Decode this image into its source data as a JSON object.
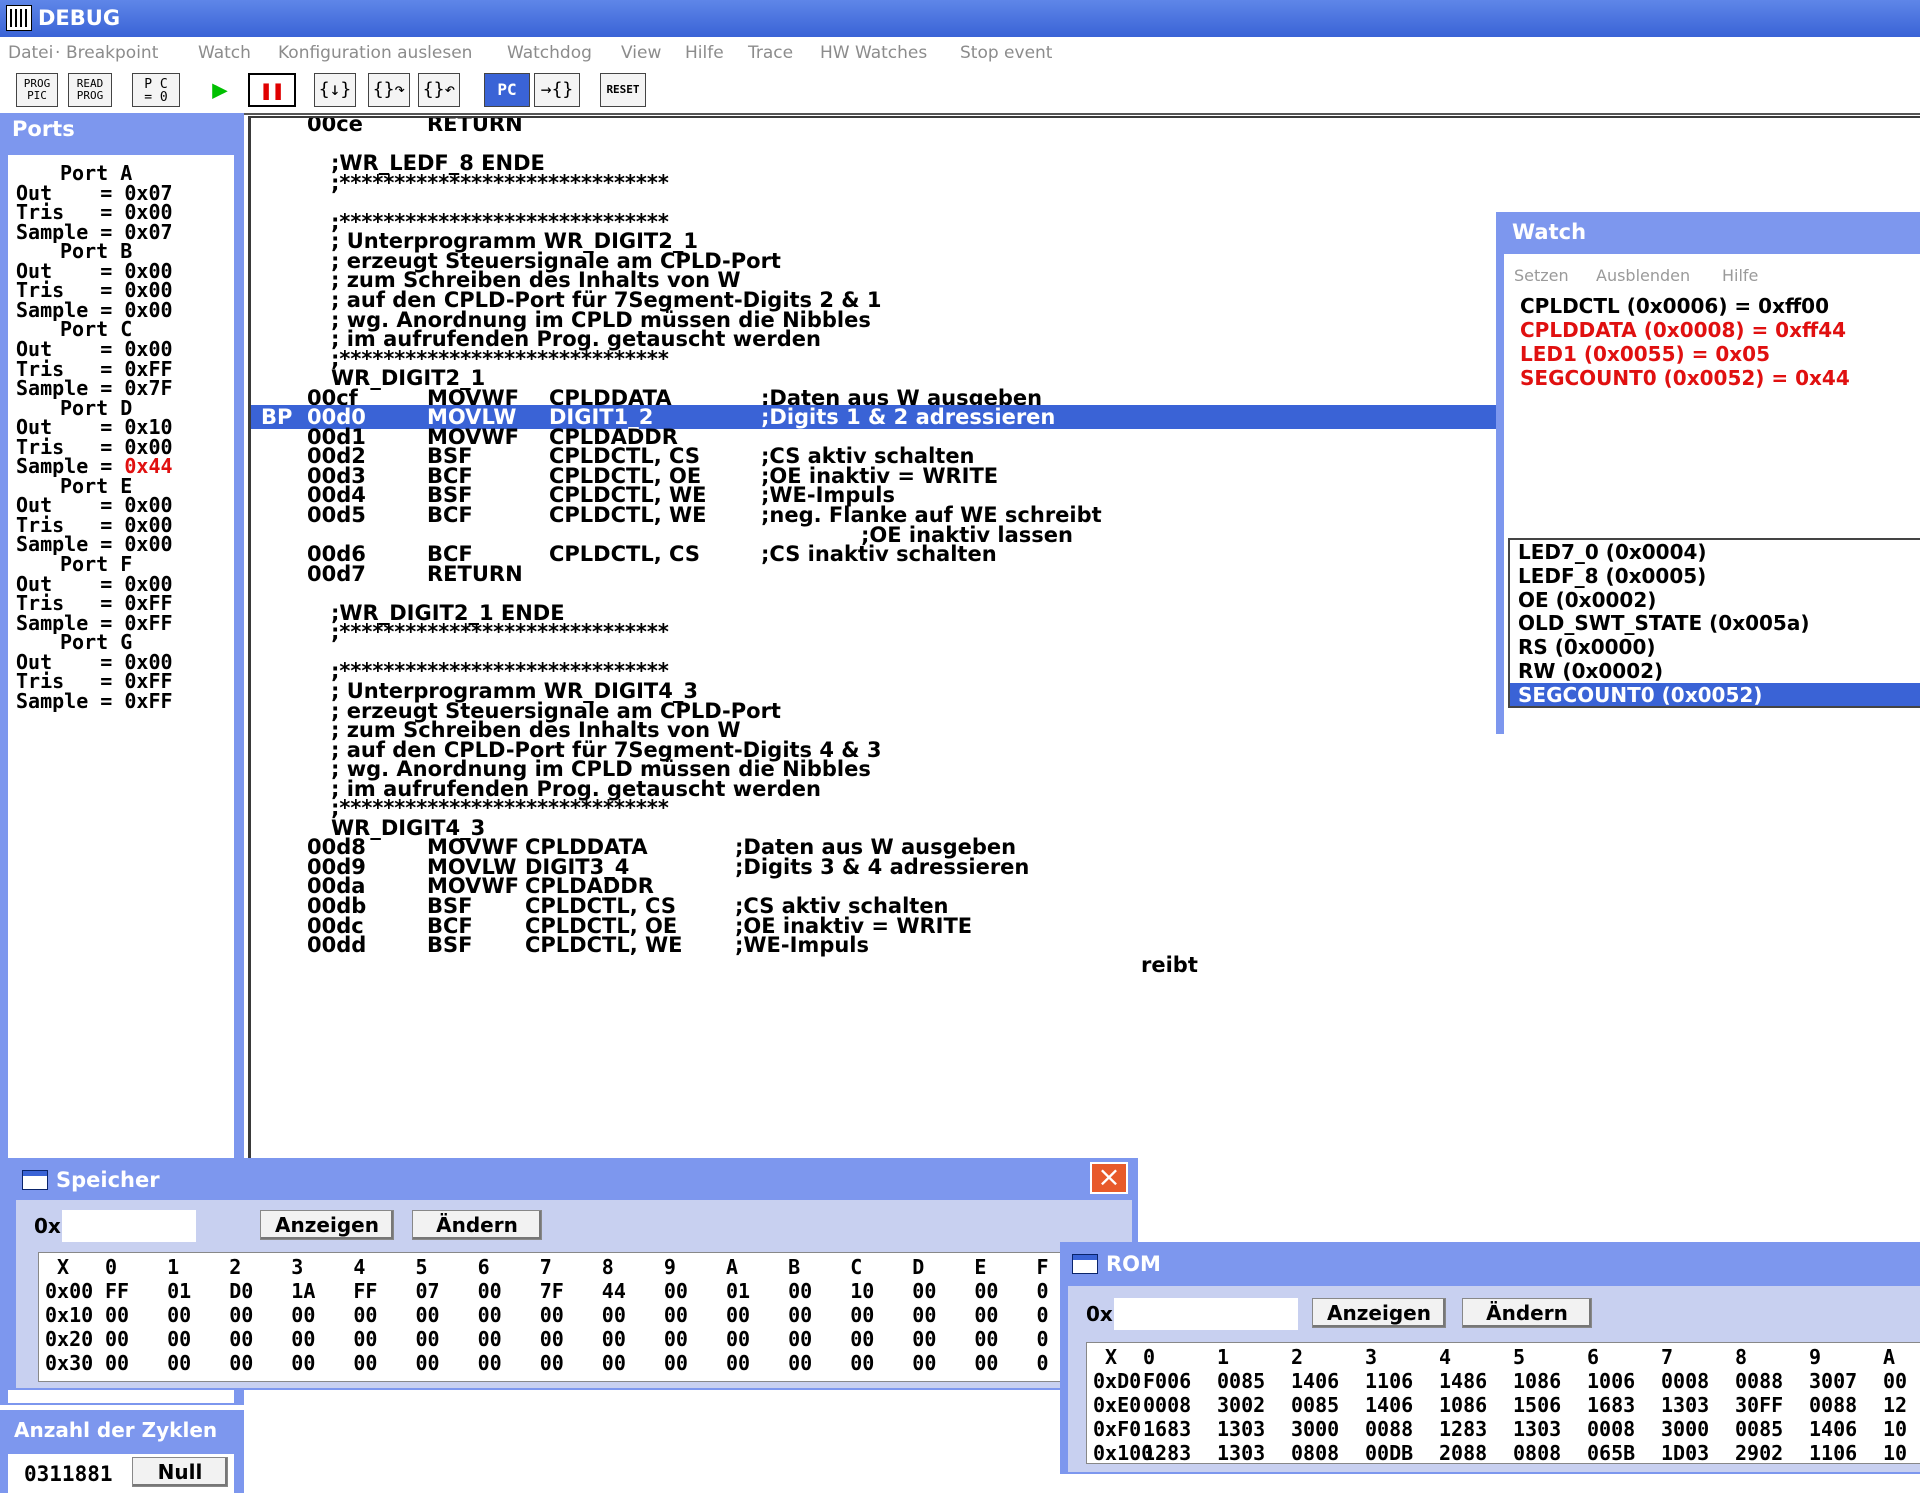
{
  "title": "DEBUG",
  "menu": [
    "Datei",
    "·",
    "Breakpoint",
    "Watch",
    "Konfiguration auslesen",
    "Watchdog",
    "View",
    "Hilfe",
    "Trace",
    "HW Watches",
    "Stop event"
  ],
  "toolbar": {
    "prog_pic": [
      "PROG",
      "PIC"
    ],
    "read_prog": [
      "READ",
      "PROG"
    ],
    "pc_zero": [
      "P C",
      "= 0"
    ],
    "run": "▶",
    "pause": "❚❚",
    "step_into": "{↓}",
    "step_over": "{}↷",
    "step_out": "{}↶",
    "pc": "PC",
    "goto_pc": "→{}",
    "reset": "RESET"
  },
  "ports": {
    "title": "Ports",
    "lines": [
      {
        "hdr": "Port A"
      },
      {
        "text": "Out    = 0x07"
      },
      {
        "text": "Tris   = 0x00"
      },
      {
        "text": "Sample = 0x07"
      },
      {
        "hdr": "Port B"
      },
      {
        "text": "Out    = 0x00"
      },
      {
        "text": "Tris   = 0x00"
      },
      {
        "text": "Sample = 0x00"
      },
      {
        "hdr": "Port C"
      },
      {
        "text": "Out    = 0x00"
      },
      {
        "text": "Tris   = 0xFF"
      },
      {
        "text": "Sample = 0x7F"
      },
      {
        "hdr": "Port D"
      },
      {
        "text": "Out    = 0x10"
      },
      {
        "text": "Tris   = 0x00"
      },
      {
        "text": "Sample = ",
        "red": "0x44"
      },
      {
        "hdr": "Port E"
      },
      {
        "text": "Out    = 0x00"
      },
      {
        "text": "Tris   = 0x00"
      },
      {
        "text": "Sample = 0x00"
      },
      {
        "hdr": "Port F"
      },
      {
        "text": "Out    = 0x00"
      },
      {
        "text": "Tris   = 0xFF"
      },
      {
        "text": "Sample = 0xFF"
      },
      {
        "hdr": "Port G"
      },
      {
        "text": "Out    = 0x00"
      },
      {
        "text": "Tris   = 0xFF"
      },
      {
        "text": "Sample = 0xFF"
      }
    ]
  },
  "code": [
    {
      "addr": "00ce",
      "op": "RETURN",
      "arg": "",
      "cmt": ""
    },
    {
      "blank": true
    },
    {
      "text": ";WR_LEDF_8 ENDE"
    },
    {
      "text": ";******************************"
    },
    {
      "blank": true
    },
    {
      "text": ";******************************"
    },
    {
      "text": "; Unterprogramm WR_DIGIT2_1"
    },
    {
      "text": "; erzeugt Steuersignale am CPLD-Port"
    },
    {
      "text": "; zum Schreiben des Inhalts von W"
    },
    {
      "text": "; auf den CPLD-Port für 7Segment-Digits 2 & 1"
    },
    {
      "text": "; wg. Anordnung im CPLD müssen die Nibbles"
    },
    {
      "text": "; im aufrufenden Prog. getauscht werden"
    },
    {
      "text": ";******************************"
    },
    {
      "text": "WR_DIGIT2_1"
    },
    {
      "addr": "00cf",
      "op": "MOVWF",
      "arg": "CPLDDATA",
      "cmt": ";Daten aus W ausgeben"
    },
    {
      "bp": "BP",
      "addr": "00d0",
      "op": "MOVLW",
      "arg": "DIGIT1_2",
      "cmt": ";Digits 1 & 2 adressieren"
    },
    {
      "addr": "00d1",
      "op": "MOVWF",
      "arg": "CPLDADDR",
      "cmt": ""
    },
    {
      "addr": "00d2",
      "op": "BSF",
      "arg": "CPLDCTL, CS",
      "cmt": ";CS aktiv schalten"
    },
    {
      "addr": "00d3",
      "op": "BCF",
      "arg": "CPLDCTL, OE",
      "cmt": ";OE inaktiv = WRITE"
    },
    {
      "addr": "00d4",
      "op": "BSF",
      "arg": "CPLDCTL, WE",
      "cmt": ";WE-Impuls"
    },
    {
      "addr": "00d5",
      "op": "BCF",
      "arg": "CPLDCTL, WE",
      "cmt": ";neg. Flanke auf WE schreibt"
    },
    {
      "cmt_only": ";OE inaktiv lassen"
    },
    {
      "addr": "00d6",
      "op": "BCF",
      "arg": "CPLDCTL, CS",
      "cmt": ";CS inaktiv schalten"
    },
    {
      "addr": "00d7",
      "op": "RETURN",
      "arg": "",
      "cmt": ""
    },
    {
      "blank": true
    },
    {
      "text": ";WR_DIGIT2_1 ENDE"
    },
    {
      "text": ";******************************"
    },
    {
      "blank": true
    },
    {
      "text": ";******************************"
    },
    {
      "text": "; Unterprogramm WR_DIGIT4_3"
    },
    {
      "text": "; erzeugt Steuersignale am CPLD-Port"
    },
    {
      "text": "; zum Schreiben des Inhalts von W"
    },
    {
      "text": "; auf den CPLD-Port für 7Segment-Digits 4 & 3"
    },
    {
      "text": "; wg. Anordnung im CPLD müssen die Nibbles"
    },
    {
      "text": "; im aufrufenden Prog. getauscht werden"
    },
    {
      "text": ";******************************"
    },
    {
      "text": "WR_DIGIT4_3"
    },
    {
      "addr": "00d8",
      "op": "MOVWF",
      "arg": "CPLDDATA",
      "cmt": ";Daten aus W ausgeben",
      "alt": true
    },
    {
      "addr": "00d9",
      "op": "MOVLW",
      "arg": "DIGIT3_4",
      "cmt": ";Digits 3 & 4 adressieren",
      "alt": true
    },
    {
      "addr": "00da",
      "op": "MOVWF",
      "arg": "CPLDADDR",
      "cmt": "",
      "alt": true
    },
    {
      "addr": "00db",
      "op": "BSF",
      "arg": "CPLDCTL, CS",
      "cmt": ";CS aktiv schalten",
      "alt": true
    },
    {
      "addr": "00dc",
      "op": "BCF",
      "arg": "CPLDCTL, OE",
      "cmt": ";OE inaktiv = WRITE",
      "alt": true
    },
    {
      "addr": "00dd",
      "op": "BSF",
      "arg": "CPLDCTL, WE",
      "cmt": ";WE-Impuls",
      "alt": true
    }
  ],
  "code_partial": "reibt",
  "watch": {
    "title": "Watch",
    "menu": [
      "Setzen",
      "Ausblenden",
      "Hilfe"
    ],
    "values": [
      {
        "text": "CPLDCTL (0x0006) = 0xff00",
        "color": "#000000"
      },
      {
        "text": "CPLDDATA (0x0008) = 0xff44",
        "color": "#e01010"
      },
      {
        "text": "LED1 (0x0055) = 0x05",
        "color": "#e01010"
      },
      {
        "text": "SEGCOUNT0 (0x0052) = 0x44",
        "color": "#e01010"
      }
    ],
    "list": [
      "LED7_0 (0x0004)",
      "LEDF_8 (0x0005)",
      "OE (0x0002)",
      "OLD_SWT_STATE (0x005a)",
      "RS (0x0000)",
      "RW (0x0002)",
      "SEGCOUNT0 (0x0052)"
    ],
    "selected_index": 6
  },
  "speicher": {
    "title": "Speicher",
    "prefix": "0x",
    "input_value": "",
    "btn_show": "Anzeigen",
    "btn_change": "Ändern",
    "header": [
      "X",
      "0",
      "1",
      "2",
      "3",
      "4",
      "5",
      "6",
      "7",
      "8",
      "9",
      "A",
      "B",
      "C",
      "D",
      "E",
      "F"
    ],
    "rows": [
      [
        "0x00",
        "FF",
        "01",
        "D0",
        "1A",
        "FF",
        "07",
        "00",
        "7F",
        "44",
        "00",
        "01",
        "00",
        "10",
        "00",
        "00",
        "0"
      ],
      [
        "0x10",
        "00",
        "00",
        "00",
        "00",
        "00",
        "00",
        "00",
        "00",
        "00",
        "00",
        "00",
        "00",
        "00",
        "00",
        "00",
        "0"
      ],
      [
        "0x20",
        "00",
        "00",
        "00",
        "00",
        "00",
        "00",
        "00",
        "00",
        "00",
        "00",
        "00",
        "00",
        "00",
        "00",
        "00",
        "0"
      ],
      [
        "0x30",
        "00",
        "00",
        "00",
        "00",
        "00",
        "00",
        "00",
        "00",
        "00",
        "00",
        "00",
        "00",
        "00",
        "00",
        "00",
        "0"
      ]
    ]
  },
  "rom": {
    "title": "ROM",
    "prefix": "0x",
    "input_value": "",
    "btn_show": "Anzeigen",
    "btn_change": "Ändern",
    "header": [
      "X",
      "0",
      "1",
      "2",
      "3",
      "4",
      "5",
      "6",
      "7",
      "8",
      "9",
      "A"
    ],
    "rows": [
      [
        "0xD0",
        "F006",
        "0085",
        "1406",
        "1106",
        "1486",
        "1086",
        "1006",
        "0008",
        "0088",
        "3007",
        "00"
      ],
      [
        "0xE0",
        "0008",
        "3002",
        "0085",
        "1406",
        "1086",
        "1506",
        "1683",
        "1303",
        "30FF",
        "0088",
        "12"
      ],
      [
        "0xF0",
        "1683",
        "1303",
        "3000",
        "0088",
        "1283",
        "1303",
        "0008",
        "3000",
        "0085",
        "1406",
        "10"
      ],
      [
        "0x100",
        "1283",
        "1303",
        "0808",
        "00DB",
        "2088",
        "0808",
        "065B",
        "1D03",
        "2902",
        "1106",
        "10"
      ]
    ]
  },
  "cycles": {
    "title": "Anzahl der Zyklen",
    "value": "0311881",
    "btn_zero": "Null"
  },
  "colors": {
    "titlebar": "#3a63d6",
    "panel": "#7d97ee",
    "highlight": "#3a63d6",
    "changed_value": "#e01010"
  }
}
